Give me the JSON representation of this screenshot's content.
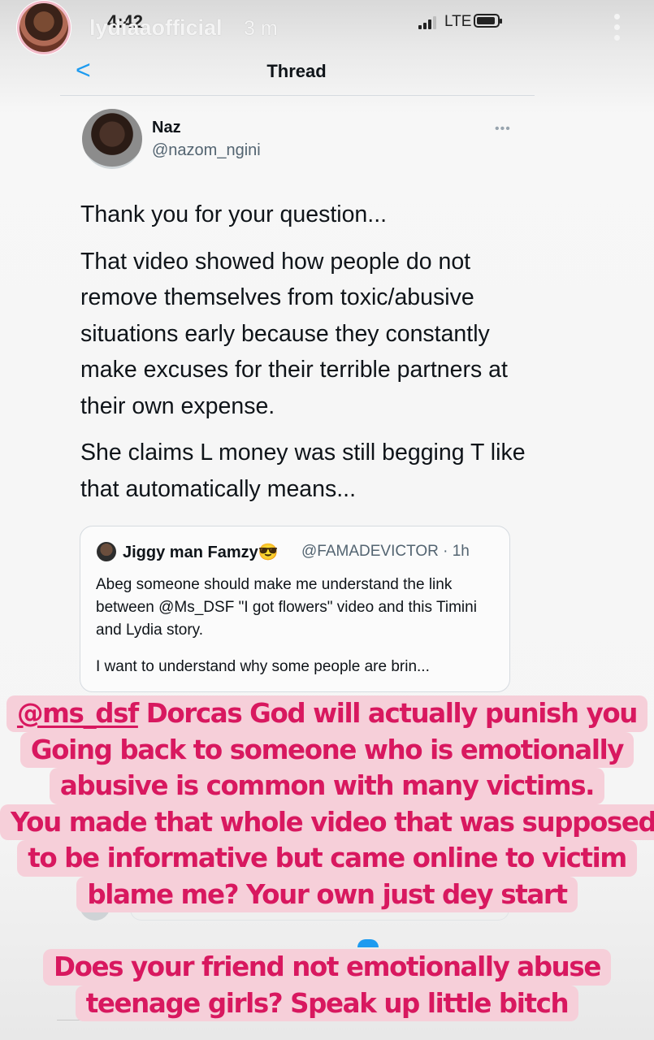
{
  "story": {
    "username": "lydiaaofficial",
    "time_ago": "3 m"
  },
  "status_bar": {
    "clock": "4:42",
    "network": "LTE"
  },
  "thread_header": {
    "title": "Thread",
    "back_label": "<"
  },
  "tweet": {
    "author_name": "Naz",
    "author_handle": "@nazom_ngini",
    "more_label": "•••",
    "paragraphs": [
      "Thank you for your question...",
      "That video showed how people do not remove themselves from toxic/abusive situations early because they constantly make excuses for their terrible partners at their own expense.",
      "She claims L money was still begging T like that automatically means..."
    ]
  },
  "quoted_tweet": {
    "author_name": "Jiggy man Famzy😎",
    "handle_time": "@FAMADEVICTOR · 1h",
    "paragraphs": [
      "Abeg someone should make me understand the link between @Ms_DSF \"I got flowers\" video and this Timini and Lydia story.",
      "I want to understand why some people are brin..."
    ]
  },
  "stickers": {
    "first": {
      "mention": "@ms_dsf",
      "lines": [
        " Dorcas God will actually punish you",
        "Going back to someone who is emotionally",
        "abusive is common with many victims.",
        "You made that whole video that was supposed",
        "to be informative but came online to victim",
        "blame me? Your own just dey start"
      ]
    },
    "second": {
      "lines": [
        "Does your friend not emotionally abuse",
        "teenage girls? Speak up little bitch"
      ]
    }
  },
  "colors": {
    "sticker_text": "#d8185f",
    "sticker_background": "#f6cfd9",
    "twitter_blue": "#1d9bf0"
  }
}
